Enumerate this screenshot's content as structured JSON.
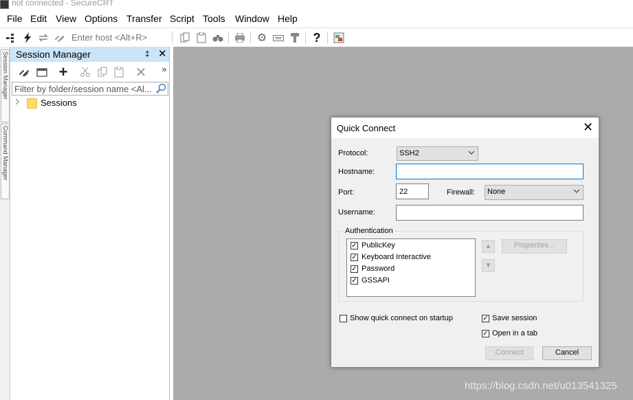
{
  "window": {
    "title": "not connected - SecureCRT"
  },
  "menu": [
    "File",
    "Edit",
    "View",
    "Options",
    "Transfer",
    "Script",
    "Tools",
    "Window",
    "Help"
  ],
  "toolbar": {
    "host_placeholder": "Enter host <Alt+R>",
    "icons": [
      "tree-icon",
      "lightning-icon",
      "reconnect-icon",
      "link-icon",
      "copy-icon",
      "paste-icon",
      "find-icon",
      "print-icon",
      "gear-icon",
      "keyboard-icon",
      "keymap-icon",
      "help-icon",
      "chat-icon"
    ]
  },
  "vertical_tabs": {
    "session_manager": "Session Manager",
    "command_manager": "Command Manager"
  },
  "session_manager": {
    "title": "Session Manager",
    "pin": "‡",
    "close": "✕",
    "more": "»",
    "filter_placeholder": "Filter by folder/session name <Al...",
    "tree": [
      {
        "label": "Sessions"
      }
    ]
  },
  "quick_connect": {
    "title": "Quick Connect",
    "close": "✕",
    "protocol_label": "Protocol:",
    "protocol_value": "SSH2",
    "hostname_label": "Hostname:",
    "hostname_value": "",
    "port_label": "Port:",
    "port_value": "22",
    "firewall_label": "Firewall:",
    "firewall_value": "None",
    "username_label": "Username:",
    "username_value": "",
    "auth_label": "Authentication",
    "auth_methods": [
      {
        "label": "PublicKey",
        "checked": true
      },
      {
        "label": "Keyboard Interactive",
        "checked": true
      },
      {
        "label": "Password",
        "checked": true
      },
      {
        "label": "GSSAPI",
        "checked": true
      }
    ],
    "properties_label": "Properties...",
    "show_on_startup_label": "Show quick connect on startup",
    "show_on_startup_checked": false,
    "save_session_label": "Save session",
    "save_session_checked": true,
    "open_in_tab_label": "Open in a tab",
    "open_in_tab_checked": true,
    "connect_label": "Connect",
    "cancel_label": "Cancel"
  },
  "watermark": "https://blog.csdn.net/u013541325"
}
